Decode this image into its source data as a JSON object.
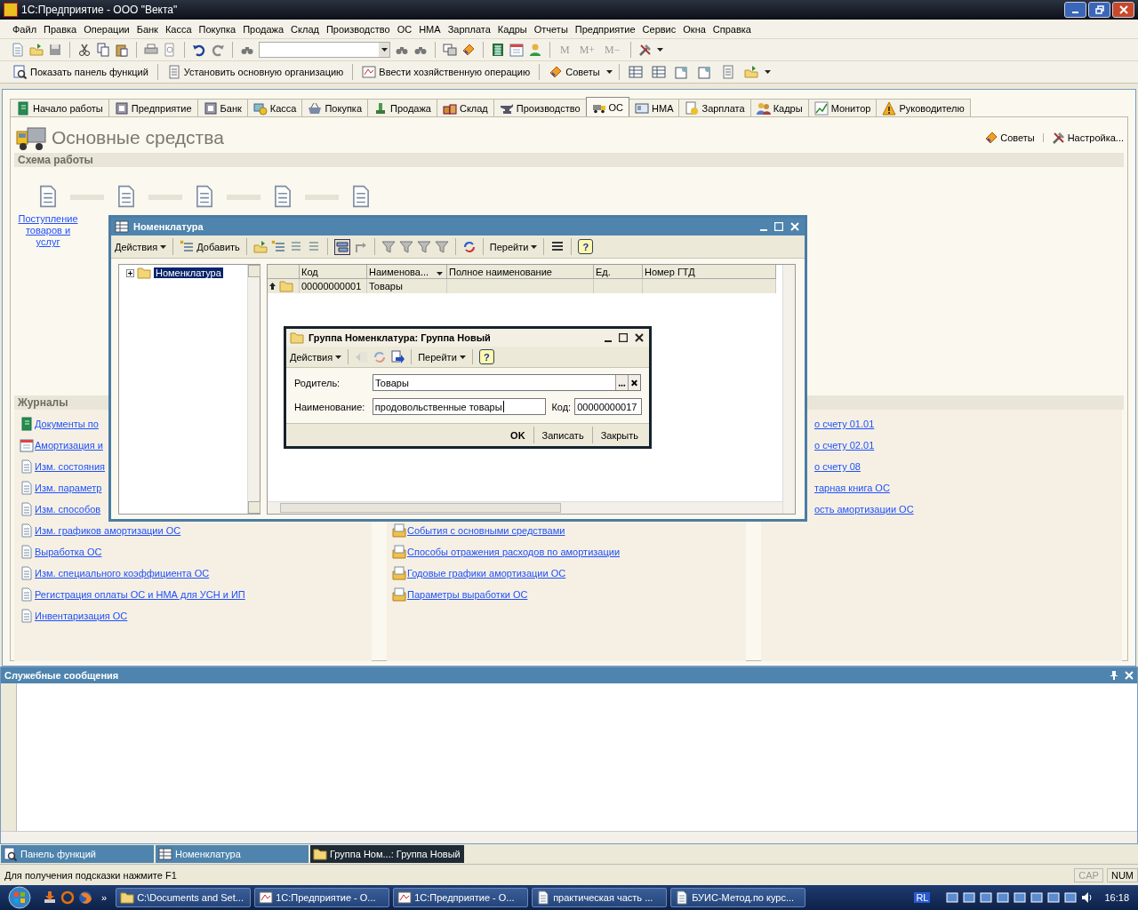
{
  "window": {
    "title": "1С:Предприятие - ООО \"Векта\""
  },
  "menu": [
    "Файл",
    "Правка",
    "Операции",
    "Банк",
    "Касса",
    "Покупка",
    "Продажа",
    "Склад",
    "Производство",
    "ОС",
    "НМА",
    "Зарплата",
    "Кадры",
    "Отчеты",
    "Предприятие",
    "Сервис",
    "Окна",
    "Справка"
  ],
  "toolbar": {
    "memory_buttons": [
      "M",
      "M+",
      "M−"
    ]
  },
  "quick_actions": [
    "Показать панель функций",
    "Установить основную организацию",
    "Ввести хозяйственную операцию",
    "Советы"
  ],
  "tabs": [
    {
      "label": "Начало работы",
      "selected": false
    },
    {
      "label": "Предприятие",
      "selected": false
    },
    {
      "label": "Банк",
      "selected": false
    },
    {
      "label": "Касса",
      "selected": false
    },
    {
      "label": "Покупка",
      "selected": false
    },
    {
      "label": "Продажа",
      "selected": false
    },
    {
      "label": "Склад",
      "selected": false
    },
    {
      "label": "Производство",
      "selected": false
    },
    {
      "label": "ОС",
      "selected": true
    },
    {
      "label": "НМА",
      "selected": false
    },
    {
      "label": "Зарплата",
      "selected": false
    },
    {
      "label": "Кадры",
      "selected": false
    },
    {
      "label": "Монитор",
      "selected": false
    },
    {
      "label": "Руководителю",
      "selected": false
    }
  ],
  "page": {
    "title": "Основные средства",
    "actions": [
      "Советы",
      "Настройка..."
    ],
    "scheme": {
      "title": "Схема работы",
      "links": [
        "Поступление товаров и услуг"
      ]
    },
    "journals": {
      "title": "Журналы",
      "columns": [
        {
          "items": [
            {
              "label": "Документы по",
              "kind": "journal"
            },
            {
              "label": "Амортизация и",
              "kind": "calendar"
            },
            {
              "label": "Изм. состояния",
              "kind": "document"
            },
            {
              "label": "Изм. параметр",
              "kind": "document"
            },
            {
              "label": "Изм. способов",
              "kind": "document"
            },
            {
              "label": "Изм. графиков амортизации ОС",
              "kind": "document"
            },
            {
              "label": "Выработка ОС",
              "kind": "document"
            },
            {
              "label": "Изм. специального коэффициента ОС",
              "kind": "document"
            },
            {
              "label": "Регистрация оплаты ОС и НМА для УСН и ИП",
              "kind": "document"
            },
            {
              "label": "Инвентаризация ОС",
              "kind": "document"
            }
          ]
        },
        {
          "items": [
            {
              "label": "События с основными средствами",
              "kind": "catalog"
            },
            {
              "label": "Способы отражения расходов по амортизации",
              "kind": "catalog"
            },
            {
              "label": "Годовые графики амортизации ОС",
              "kind": "catalog"
            },
            {
              "label": "Параметры выработки ОС",
              "kind": "catalog"
            }
          ]
        },
        {
          "items": [
            {
              "label": "о счету 01.01"
            },
            {
              "label": "о счету 02.01"
            },
            {
              "label": "о счету 08"
            },
            {
              "label": "тарная книга ОС"
            },
            {
              "label": "ость амортизации ОС"
            }
          ]
        }
      ]
    }
  },
  "nomenclature": {
    "title": "Номенклатура",
    "toolbar": {
      "actions": "Действия",
      "add": "Добавить",
      "goto": "Перейти",
      "help": "?"
    },
    "tree": [
      {
        "label": "Номенклатура",
        "selected": true,
        "expanded": false
      }
    ],
    "columns": [
      "Код",
      "Наименова...",
      "Полное наименование",
      "Ед.",
      "Номер ГТД"
    ],
    "rows": [
      {
        "code": "00000000001",
        "name": "Товары"
      }
    ]
  },
  "group_dialog": {
    "title": "Группа Номенклатура: Группа Новый",
    "toolbar": {
      "actions": "Действия",
      "goto": "Перейти",
      "help": "?"
    },
    "parent_label": "Родитель:",
    "parent_value": "Товары",
    "name_label": "Наименование:",
    "name_value": "продовольственные товары",
    "code_label": "Код:",
    "code_value": "00000000017",
    "buttons": [
      "OK",
      "Записать",
      "Закрыть"
    ]
  },
  "messages_panel": {
    "title": "Служебные сообщения"
  },
  "window_bar": [
    {
      "label": "Панель функций",
      "selected": false
    },
    {
      "label": "Номенклатура",
      "selected": false
    },
    {
      "label": "Группа Ном...: Группа Новый",
      "selected": true
    }
  ],
  "status_bar": {
    "hint": "Для получения подсказки нажмите F1",
    "indicators": [
      {
        "label": "CAP",
        "on": false
      },
      {
        "label": "NUM",
        "on": true
      }
    ]
  },
  "taskbar": {
    "quick_launch_more": "»",
    "tasks": [
      "C:\\Documents and Set...",
      "1С:Предприятие - О...",
      "1С:Предприятие - О...",
      "практическая часть ...",
      "БУИС-Метод.по курс..."
    ],
    "tray_text": "RL",
    "clock": "16:18"
  }
}
